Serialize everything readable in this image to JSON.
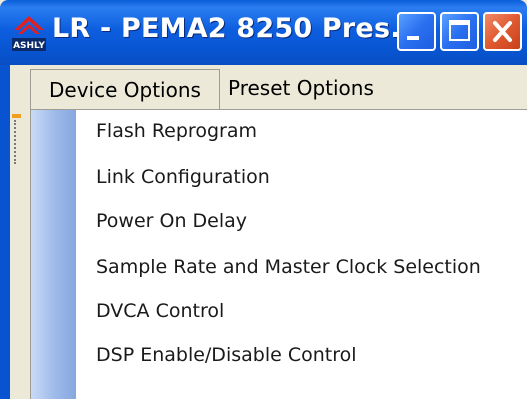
{
  "window": {
    "title": "LR - PEMA2 8250  Pres...",
    "logo_text": "ASHLY",
    "controls": [
      "minimize",
      "maximize",
      "close"
    ],
    "colors": {
      "titlebar": "#0854d0",
      "close": "#e05a30",
      "menu_bg": "#ece9d8"
    }
  },
  "menubar": {
    "items": [
      {
        "label": "Device Options",
        "active": true
      },
      {
        "label": "Preset Options",
        "active": false
      }
    ]
  },
  "dropdown": {
    "items": [
      {
        "label": "Flash Reprogram"
      },
      {
        "label": "Link Configuration"
      },
      {
        "label": "Power On Delay"
      },
      {
        "label": "Sample Rate and Master Clock Selection"
      },
      {
        "label": "DVCA Control"
      },
      {
        "label": "DSP Enable/Disable Control"
      }
    ]
  }
}
